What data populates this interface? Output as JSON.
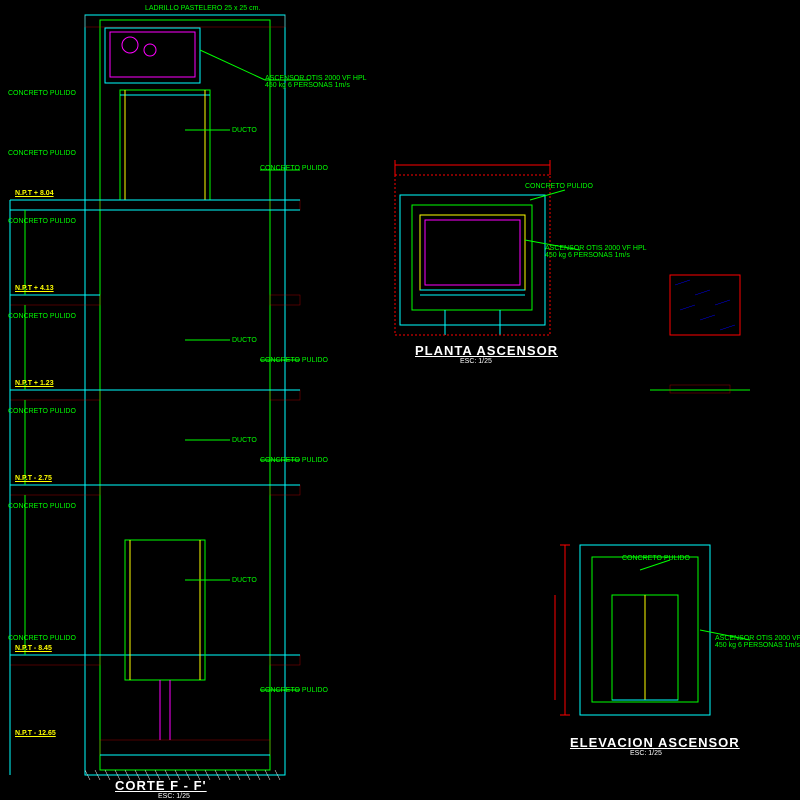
{
  "titles": {
    "corte": "CORTE F - F'",
    "corte_scale": "ESC: 1/25",
    "planta": "PLANTA ASCENSOR",
    "planta_scale": "ESC: 1/25",
    "elevacion": "ELEVACION ASCENSOR",
    "elevacion_scale": "ESC: 1/25"
  },
  "levels": {
    "npt_804": "N.P.T + 8.04",
    "npt_413": "N.P.T + 4.13",
    "npt_123": "N.P.T + 1.23",
    "npt_275": "N.P.T - 2.75",
    "npt_845": "N.P.T - 8.45",
    "npt_1265": "N.P.T - 12.65"
  },
  "labels": {
    "concreto_pulido": "CONCRETO PULIDO",
    "ducto": "DUCTO",
    "ladrillo": "LADRILLO PASTELERO 25 x 25 cm.",
    "ascensor_spec": "ASCENSOR OTIS 2000 VF HPL\n450 kg 6 PERSONAS 1m/s"
  }
}
